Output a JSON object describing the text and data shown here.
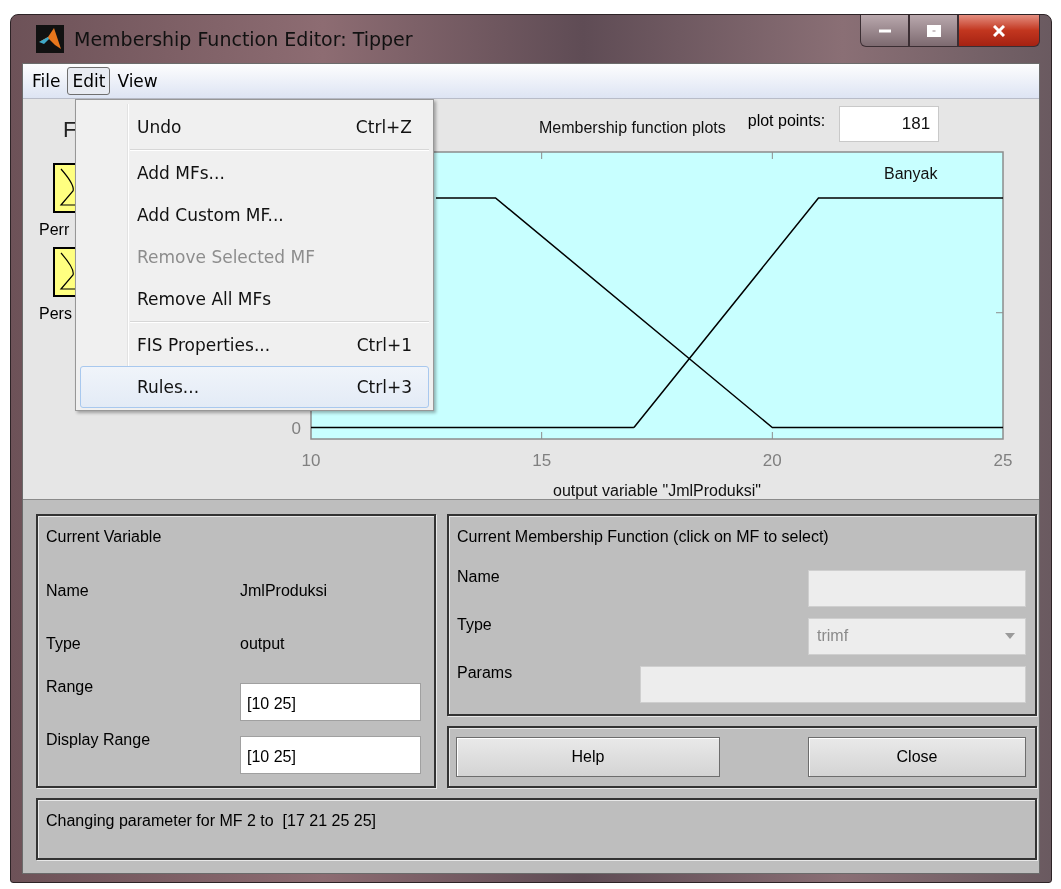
{
  "window": {
    "title": "Membership Function Editor: Tipper"
  },
  "menu_bar": [
    {
      "label": "File",
      "selected": false
    },
    {
      "label": "Edit",
      "selected": true
    },
    {
      "label": "View",
      "selected": false
    }
  ],
  "edit_menu": [
    {
      "kind": "item",
      "label": "Undo",
      "shortcut": "Ctrl+Z",
      "disabled": false,
      "selected": false
    },
    {
      "kind": "separator"
    },
    {
      "kind": "item",
      "label": "Add MFs...",
      "disabled": false,
      "selected": false
    },
    {
      "kind": "item",
      "label": "Add Custom MF...",
      "disabled": false,
      "selected": false
    },
    {
      "kind": "item",
      "label": "Remove Selected MF",
      "disabled": true,
      "selected": false
    },
    {
      "kind": "item",
      "label": "Remove All MFs",
      "disabled": false,
      "selected": false
    },
    {
      "kind": "separator"
    },
    {
      "kind": "item",
      "label": "FIS Properties...",
      "shortcut": "Ctrl+1",
      "disabled": false,
      "selected": false
    },
    {
      "kind": "item",
      "label": "Rules...",
      "shortcut": "Ctrl+3",
      "disabled": false,
      "selected": true
    }
  ],
  "fis_variables": {
    "heading": "F",
    "variables": [
      {
        "label": "Perr"
      },
      {
        "label": "Pers"
      }
    ]
  },
  "plot": {
    "plot_points_label": "plot points:",
    "plot_points": "181",
    "title": "Membership function plots",
    "x_tick_labels": [
      "10",
      "15",
      "20",
      "25"
    ],
    "y_tick_label": "0",
    "curve_label": "Banyak",
    "axis_label": "output variable \"JmlProduksi\""
  },
  "current_variable": {
    "heading": "Current Variable",
    "fields": [
      {
        "kind": "text",
        "label": "Name",
        "value": "JmlProduksi"
      },
      {
        "kind": "text",
        "label": "Type",
        "value": "output"
      },
      {
        "kind": "input",
        "label": "Range",
        "value": "[10 25]"
      },
      {
        "kind": "input",
        "label": "Display Range",
        "value": "[10 25]"
      }
    ]
  },
  "current_mf": {
    "heading": "Current Membership Function (click on MF to select)",
    "fields": [
      {
        "kind": "input",
        "label": "Name",
        "disabled": true
      },
      {
        "kind": "dropdown",
        "label": "Type",
        "value": "trimf",
        "disabled": true
      },
      {
        "kind": "wide_input",
        "label": "Params",
        "disabled": true
      }
    ]
  },
  "buttons": [
    "Help",
    "Close"
  ],
  "status": "Changing parameter for MF 2 to  [17 21 25 25]"
}
